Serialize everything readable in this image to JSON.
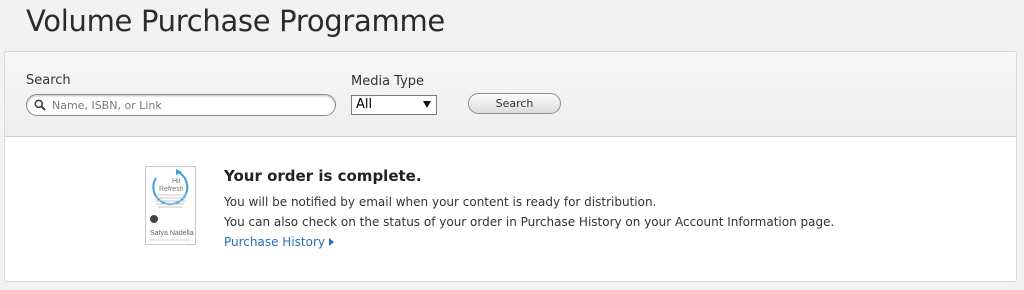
{
  "page": {
    "title": "Volume Purchase Programme"
  },
  "search": {
    "label": "Search",
    "placeholder": "Name, ISBN, or Link",
    "button_label": "Search"
  },
  "media_type": {
    "label": "Media Type",
    "selected": "All"
  },
  "order": {
    "title": "Your order is complete.",
    "message_notify": "You will be notified by email when your content is ready for distribution.",
    "message_status": "You can also check on the status of your order in Purchase History on your Account Information page.",
    "link_label": "Purchase History"
  },
  "book": {
    "title_line1": "Hit",
    "title_line2": "Refresh",
    "author": "Satya Nadella"
  },
  "colors": {
    "link": "#2a6ebb",
    "book_accent": "#3ea1dc"
  }
}
